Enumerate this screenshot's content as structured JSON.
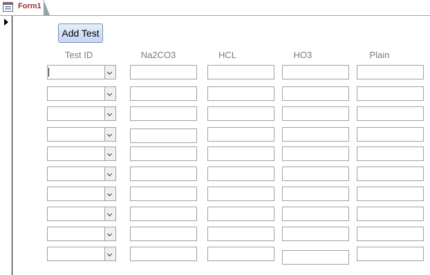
{
  "tab": {
    "label": "Form1",
    "icon": "form-icon"
  },
  "record_selector": {
    "icon": "current-record-arrow-icon"
  },
  "add_button": {
    "label": "Add Test"
  },
  "columns": [
    {
      "key": "test_id",
      "label": "Test ID",
      "type": "combo"
    },
    {
      "key": "na2co3",
      "label": "Na2CO3",
      "type": "text"
    },
    {
      "key": "hcl",
      "label": "HCL",
      "type": "text"
    },
    {
      "key": "ho3",
      "label": "HO3",
      "type": "text"
    },
    {
      "key": "plain",
      "label": "Plain",
      "type": "text"
    }
  ],
  "rows": [
    {
      "test_id": "",
      "na2co3": "",
      "hcl": "",
      "ho3": "",
      "plain": ""
    },
    {
      "test_id": "",
      "na2co3": "",
      "hcl": "",
      "ho3": "",
      "plain": ""
    },
    {
      "test_id": "",
      "na2co3": "",
      "hcl": "",
      "ho3": "",
      "plain": ""
    },
    {
      "test_id": "",
      "na2co3": "",
      "hcl": "",
      "ho3": "",
      "plain": ""
    },
    {
      "test_id": "",
      "na2co3": "",
      "hcl": "",
      "ho3": "",
      "plain": ""
    },
    {
      "test_id": "",
      "na2co3": "",
      "hcl": "",
      "ho3": "",
      "plain": ""
    },
    {
      "test_id": "",
      "na2co3": "",
      "hcl": "",
      "ho3": "",
      "plain": ""
    },
    {
      "test_id": "",
      "na2co3": "",
      "hcl": "",
      "ho3": "",
      "plain": ""
    },
    {
      "test_id": "",
      "na2co3": "",
      "hcl": "",
      "ho3": "",
      "plain": ""
    },
    {
      "test_id": "",
      "na2co3": "",
      "hcl": "",
      "ho3": "",
      "plain": ""
    }
  ]
}
